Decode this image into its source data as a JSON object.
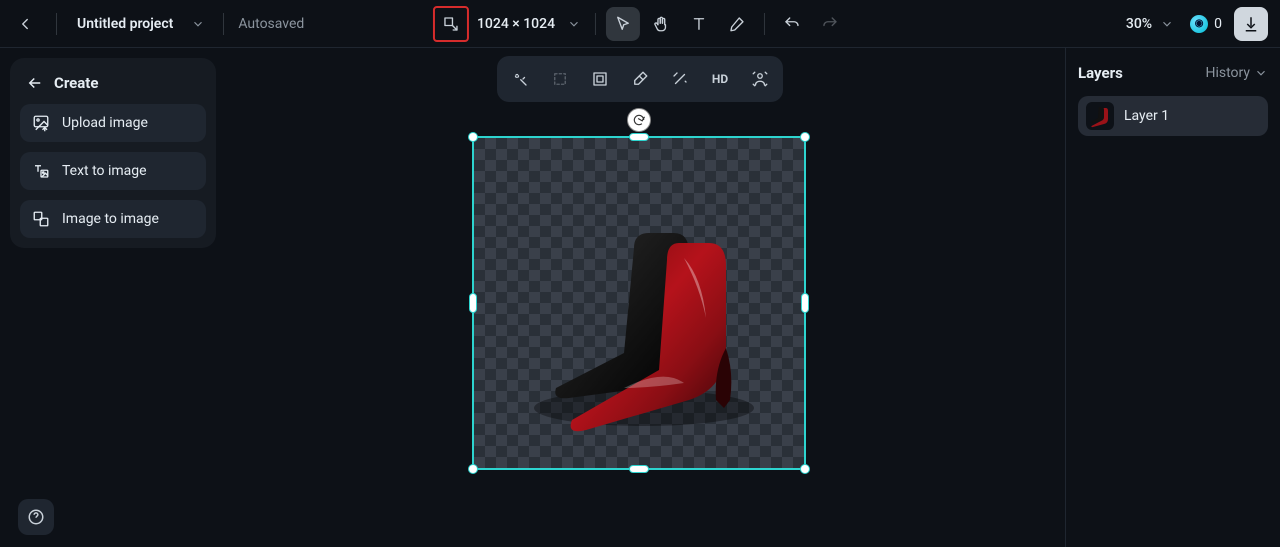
{
  "header": {
    "project_title": "Untitled project",
    "autosave_label": "Autosaved",
    "canvas_dims": "1024 × 1024",
    "zoom_label": "30%",
    "credits_value": "0"
  },
  "left_panel": {
    "heading": "Create",
    "actions": {
      "upload": "Upload image",
      "text_to_image": "Text to image",
      "image_to_image": "Image to image"
    }
  },
  "float_toolbar": {
    "hd_label": "HD"
  },
  "right_panel": {
    "title": "Layers",
    "history_label": "History",
    "layers": [
      {
        "name": "Layer 1"
      }
    ]
  },
  "icons": {
    "back": "back-icon",
    "resize": "resize-canvas-icon",
    "cursor": "cursor-icon",
    "hand": "hand-icon",
    "text": "text-icon",
    "brush": "brush-icon",
    "undo": "undo-icon",
    "redo": "redo-icon",
    "download": "download-icon",
    "help": "help-icon"
  }
}
